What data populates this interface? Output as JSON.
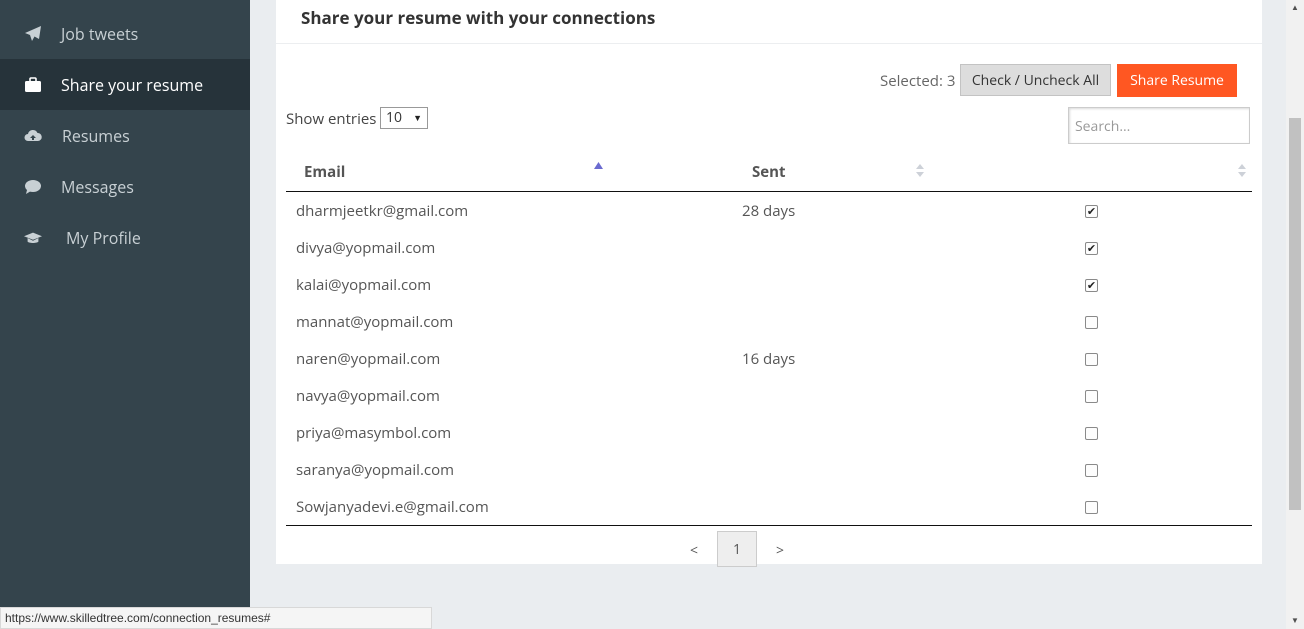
{
  "sidebar": {
    "items": [
      {
        "label": "Job tweets",
        "icon": "paper-plane-icon"
      },
      {
        "label": "Share your resume",
        "icon": "briefcase-icon",
        "active": true
      },
      {
        "label": "Resumes",
        "icon": "cloud-upload-icon"
      },
      {
        "label": "Messages",
        "icon": "chat-bubble-icon"
      },
      {
        "label": "My Profile",
        "icon": "graduation-cap-icon"
      }
    ]
  },
  "panel": {
    "title": "Share your resume with your connections",
    "selected_text": "Selected: 3",
    "check_all_label": "Check / Uncheck All",
    "share_label": "Share Resume",
    "show_entries_label": "Show entries",
    "entries_value": "10",
    "search_placeholder": "Search..."
  },
  "table": {
    "columns": [
      "Email",
      "Sent",
      ""
    ],
    "rows": [
      {
        "email": "dharmjeetkr@gmail.com",
        "sent": "28 days",
        "checked": true
      },
      {
        "email": "divya@yopmail.com",
        "sent": "",
        "checked": true
      },
      {
        "email": "kalai@yopmail.com",
        "sent": "",
        "checked": true
      },
      {
        "email": "mannat@yopmail.com",
        "sent": "",
        "checked": false
      },
      {
        "email": "naren@yopmail.com",
        "sent": "16 days",
        "checked": false
      },
      {
        "email": "navya@yopmail.com",
        "sent": "",
        "checked": false
      },
      {
        "email": "priya@masymbol.com",
        "sent": "",
        "checked": false
      },
      {
        "email": "saranya@yopmail.com",
        "sent": "",
        "checked": false
      },
      {
        "email": "Sowjanyadevi.e@gmail.com",
        "sent": "",
        "checked": false
      }
    ]
  },
  "pagination": {
    "prev": "<",
    "current": "1",
    "next": ">"
  },
  "status_bar": {
    "url": "https://www.skilledtree.com/connection_resumes#"
  },
  "colors": {
    "sidebar_bg": "#34444c",
    "sidebar_active_bg": "#26333a",
    "accent": "#ff5722",
    "sort_active": "#6b6bd0"
  }
}
